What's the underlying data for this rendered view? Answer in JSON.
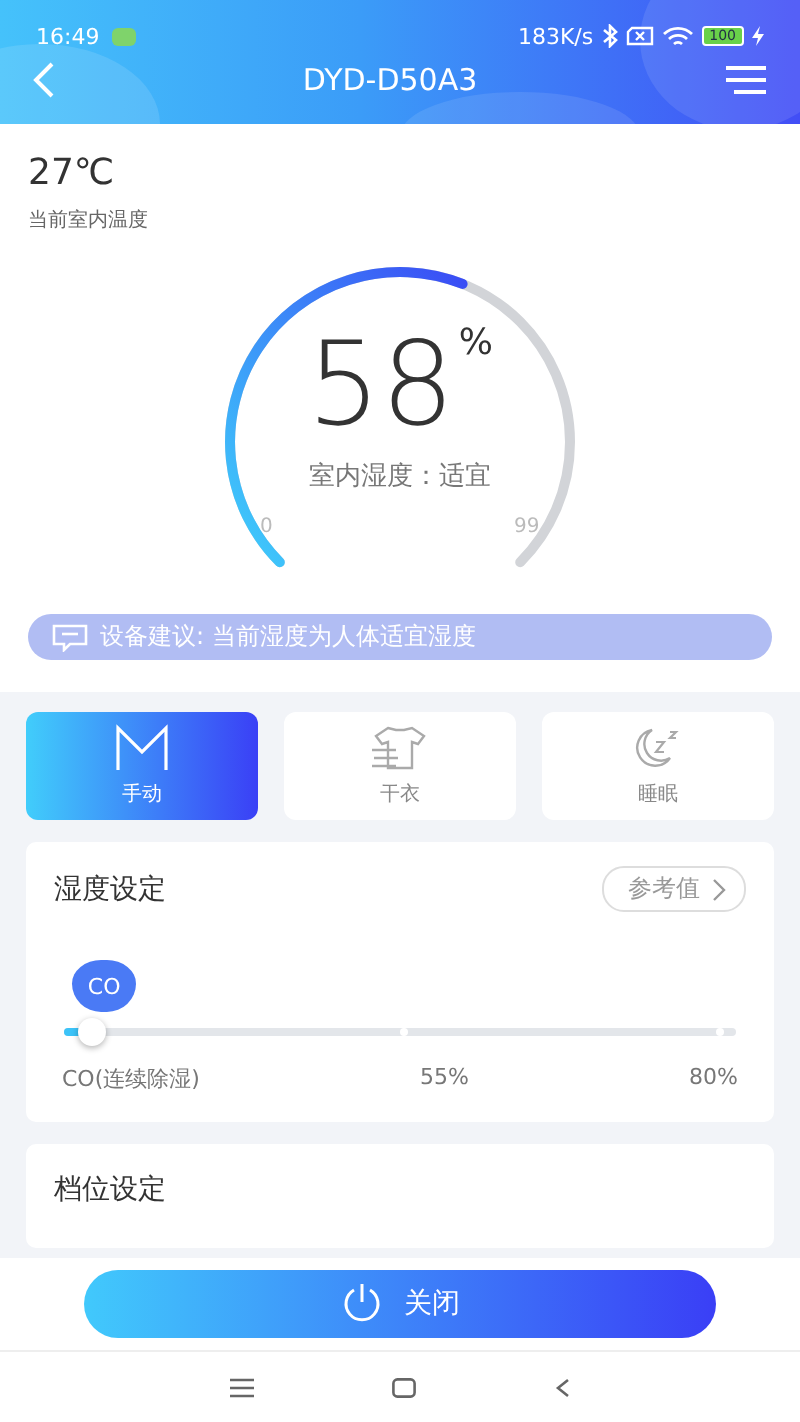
{
  "status_bar": {
    "time": "16:49",
    "net_speed": "183K/s",
    "battery": "100"
  },
  "header": {
    "title": "DYD-D50A3"
  },
  "temperature": {
    "value": "27℃",
    "label": "当前室内温度"
  },
  "gauge": {
    "value": "58",
    "unit": "%",
    "status": "室内湿度：适宜",
    "min": "0",
    "max": "99"
  },
  "advice": "设备建议: 当前湿度为人体适宜湿度",
  "modes": [
    {
      "kind": "manual",
      "label": "手动",
      "selected": true
    },
    {
      "kind": "dry",
      "label": "干衣",
      "selected": false
    },
    {
      "kind": "sleep",
      "label": "睡眠",
      "selected": false
    }
  ],
  "humidity_setting": {
    "title": "湿度设定",
    "reference_button": "参考值",
    "bubble": "CO",
    "level": 0.03,
    "ticks": [
      "CO(连续除湿)",
      "55%",
      "80%"
    ]
  },
  "gear_setting": {
    "title": "档位设定"
  },
  "power_button": "关闭"
}
